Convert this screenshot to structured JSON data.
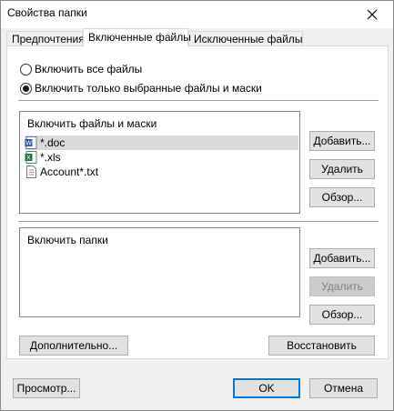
{
  "window": {
    "title": "Свойства папки"
  },
  "tabs": [
    {
      "label": "Предпочтения"
    },
    {
      "label": "Включенные файлы"
    },
    {
      "label": "Исключенные файлы"
    }
  ],
  "options": {
    "all_files": "Включить все файлы",
    "selected_files": "Включить только выбранные файлы и маски",
    "selected": "selected_files"
  },
  "files_section": {
    "caption": "Включить файлы и маски",
    "items": [
      {
        "name": "*.doc",
        "icon": "word-file-icon",
        "selected": true
      },
      {
        "name": "*.xls",
        "icon": "excel-file-icon",
        "selected": false
      },
      {
        "name": "Account*.txt",
        "icon": "text-file-icon",
        "selected": false
      }
    ],
    "add_label": "Добавить...",
    "remove_label": "Удалить",
    "browse_label": "Обзор..."
  },
  "folders_section": {
    "caption": "Включить папки",
    "add_label": "Добавить...",
    "remove_label": "Удалить",
    "browse_label": "Обзор..."
  },
  "advanced_label": "Дополнительно...",
  "restore_label": "Восстановить",
  "footer": {
    "preview_label": "Просмотр...",
    "ok_label": "OK",
    "cancel_label": "Отмена"
  },
  "colors": {
    "default_button_border": "#0078d7",
    "selection": "#d9d9d9"
  }
}
